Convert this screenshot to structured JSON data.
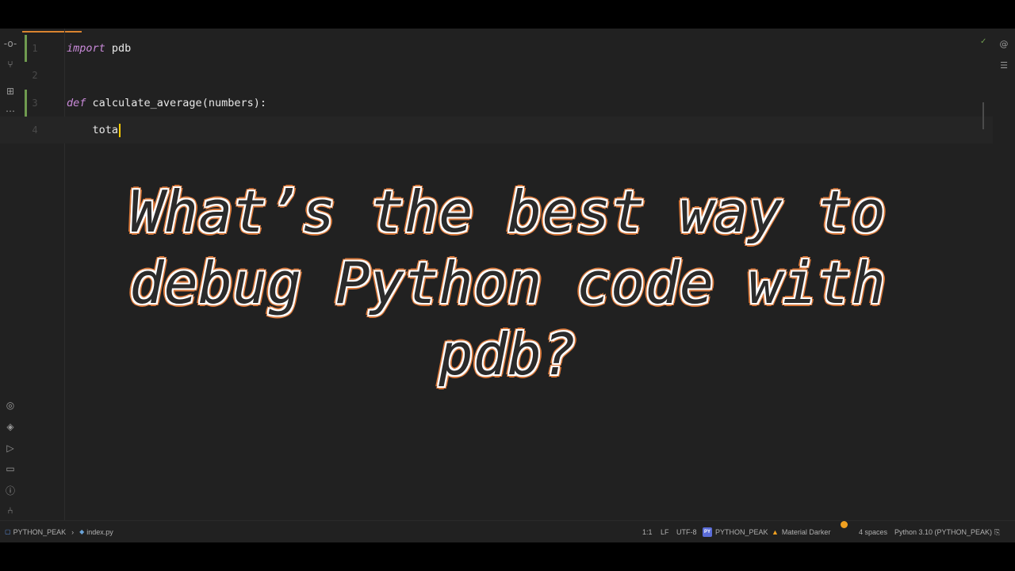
{
  "editor": {
    "lines": [
      {
        "number": "1",
        "keyword": "import",
        "rest": " pdb"
      },
      {
        "number": "2",
        "keyword": "",
        "rest": ""
      },
      {
        "number": "3",
        "keyword": "def",
        "rest": " calculate_average(numbers):"
      },
      {
        "number": "4",
        "keyword": "",
        "rest": "    tota"
      }
    ]
  },
  "overlay": {
    "line1": "What’s the best way to",
    "line2": "debug Python code with",
    "line3": "pdb?"
  },
  "left_toolbar": {
    "icons": [
      "commit-icon",
      "pull-requests-icon",
      "structure-icon",
      "more-icon",
      "python-console-icon",
      "layers-icon",
      "run-icon",
      "terminal-icon",
      "problems-icon",
      "git-icon"
    ]
  },
  "right_toolbar": {
    "icons": [
      "ai-assistant-icon",
      "database-icon"
    ]
  },
  "status_bar": {
    "project": "PYTHON_PEAK",
    "file": "index.py",
    "position": "1:1",
    "line_ending": "LF",
    "encoding": "UTF-8",
    "venv_badge": "PY",
    "venv": "PYTHON_PEAK",
    "theme": "Material Darker",
    "indent": "4 spaces",
    "interpreter": "Python 3.10 (PYTHON_PEAK)"
  },
  "colors": {
    "editor_bg": "#212121",
    "keyword": "#c98ad9",
    "change_marker": "#6f9b4f",
    "tab_accent": "#d9832f",
    "title_outline": "#d9783a"
  }
}
